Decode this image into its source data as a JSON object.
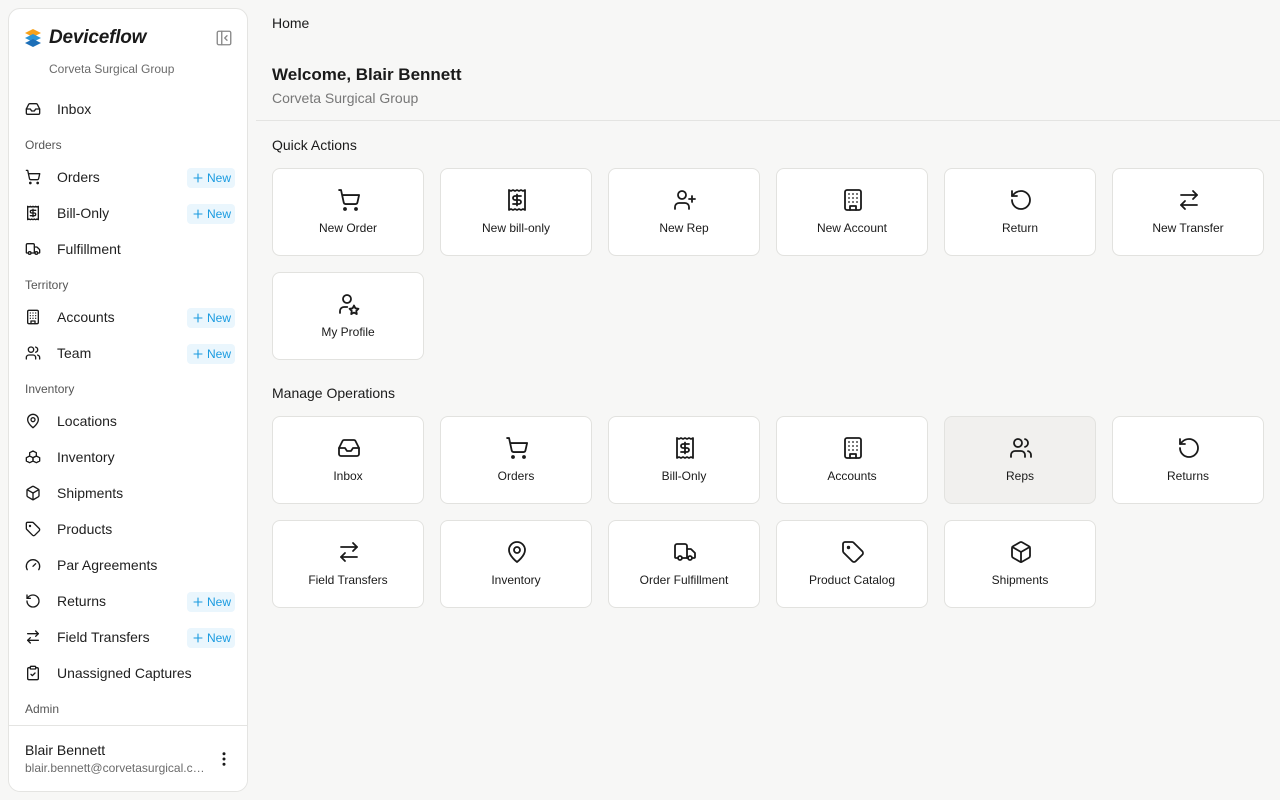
{
  "brand": {
    "name": "Deviceflow",
    "org": "Corveta Surgical Group"
  },
  "sidebar": {
    "new_label": "New",
    "inbox": "Inbox",
    "sections": {
      "orders": "Orders",
      "territory": "Territory",
      "inventory": "Inventory",
      "admin": "Admin"
    },
    "items": {
      "orders": "Orders",
      "bill_only": "Bill-Only",
      "fulfillment": "Fulfillment",
      "accounts": "Accounts",
      "team": "Team",
      "locations": "Locations",
      "inventory": "Inventory",
      "shipments": "Shipments",
      "products": "Products",
      "par_agreements": "Par Agreements",
      "returns": "Returns",
      "field_transfers": "Field Transfers",
      "unassigned_captures": "Unassigned Captures"
    }
  },
  "user": {
    "name": "Blair Bennett",
    "email": "blair.bennett@corvetasurgical.com"
  },
  "header": {
    "breadcrumb": "Home",
    "welcome": "Welcome, Blair Bennett",
    "org": "Corveta Surgical Group"
  },
  "quick_actions": {
    "title": "Quick Actions",
    "items": [
      {
        "label": "New Order",
        "icon": "shopping-cart-icon"
      },
      {
        "label": "New bill-only",
        "icon": "receipt-icon"
      },
      {
        "label": "New Rep",
        "icon": "user-plus-icon"
      },
      {
        "label": "New Account",
        "icon": "building-icon"
      },
      {
        "label": "Return",
        "icon": "rotate-ccw-icon"
      },
      {
        "label": "New Transfer",
        "icon": "arrows-transfer-icon"
      },
      {
        "label": "My Profile",
        "icon": "user-star-icon"
      }
    ]
  },
  "manage_operations": {
    "title": "Manage Operations",
    "items": [
      {
        "label": "Inbox",
        "icon": "inbox-icon"
      },
      {
        "label": "Orders",
        "icon": "shopping-cart-icon"
      },
      {
        "label": "Bill-Only",
        "icon": "receipt-icon"
      },
      {
        "label": "Accounts",
        "icon": "building-icon"
      },
      {
        "label": "Reps",
        "icon": "users-icon"
      },
      {
        "label": "Returns",
        "icon": "rotate-ccw-icon"
      },
      {
        "label": "Field Transfers",
        "icon": "arrows-transfer-icon"
      },
      {
        "label": "Inventory",
        "icon": "map-pin-icon"
      },
      {
        "label": "Order Fulfillment",
        "icon": "truck-icon"
      },
      {
        "label": "Product Catalog",
        "icon": "tag-icon"
      },
      {
        "label": "Shipments",
        "icon": "package-icon"
      }
    ]
  },
  "colors": {
    "accent": "#1a9be0",
    "badge_bg": "#eaf6fd",
    "hover_card": "#f1f0ee"
  }
}
